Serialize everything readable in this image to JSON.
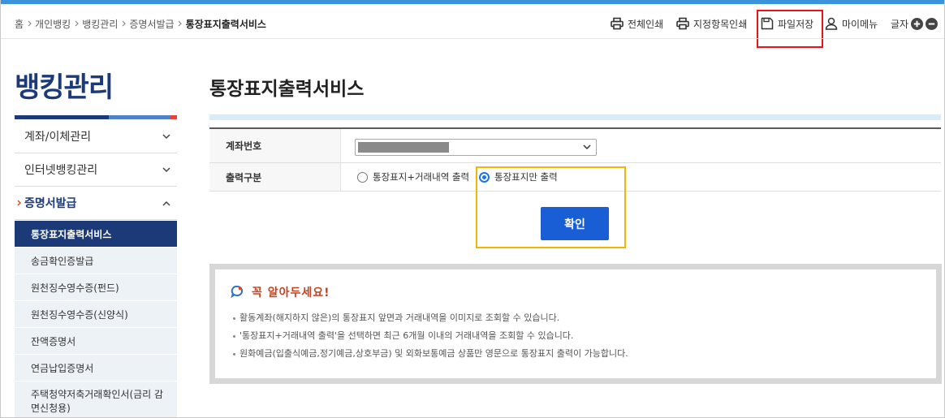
{
  "breadcrumb": {
    "home": "홈",
    "items": [
      "개인뱅킹",
      "뱅킹관리",
      "증명서발급"
    ],
    "current": "통장표지출력서비스"
  },
  "toolbar": {
    "print_all": "전체인쇄",
    "print_selected": "지정항목인쇄",
    "file_save": "파일저장",
    "my_menu": "마이메뉴",
    "font_size": "글자"
  },
  "sidebar": {
    "title": "뱅킹관리",
    "menu": [
      {
        "label": "계좌/이체관리",
        "expanded": false
      },
      {
        "label": "인터넷뱅킹관리",
        "expanded": false
      },
      {
        "label": "증명서발급",
        "expanded": true
      }
    ],
    "submenu": [
      {
        "label": "통장표지출력서비스",
        "active": true
      },
      {
        "label": "송금확인증발급",
        "active": false
      },
      {
        "label": "원천징수영수증(펀드)",
        "active": false
      },
      {
        "label": "원천징수영수증(신양식)",
        "active": false
      },
      {
        "label": "잔액증명서",
        "active": false
      },
      {
        "label": "연금납입증명서",
        "active": false
      },
      {
        "label": "주택청약저축거래확인서(금리 감면신청용)",
        "active": false
      }
    ]
  },
  "main": {
    "title": "통장표지출력서비스",
    "form": {
      "account_label": "계좌번호",
      "output_label": "출력구분",
      "output_options": [
        {
          "label": "통장표지+거래내역 출력",
          "checked": false
        },
        {
          "label": "통장표지만 출력",
          "checked": true
        }
      ]
    },
    "confirm_label": "확인"
  },
  "notice": {
    "title": "꼭 알아두세요!",
    "items": [
      "활동계좌(해지하지 않은)의 통장표지 앞면과 거래내역을 이미지로 조회할 수 있습니다.",
      "'통장표지+거래내역 출력'을 선택하면 최근 6개월 이내의 거래내역을 조회할 수 있습니다.",
      "원화예금(입출식예금,정기예금,상호부금) 및 외화보통예금 상품만 영문으로 통장표지 출력이 가능합니다."
    ]
  },
  "icons": {
    "print_all": "printer-icon",
    "print_selected": "printer-icon",
    "file_save": "save-icon",
    "my_menu": "person-icon",
    "font_increase": "plus-circle-icon",
    "font_decrease": "minus-circle-icon",
    "menu_collapsed": "chevron-down-icon",
    "menu_expanded": "chevron-up-icon",
    "notice": "notice-icon"
  },
  "colors": {
    "top_bar": "#3a93db",
    "brand_navy": "#1d3a78",
    "button_blue": "#1a5ed6",
    "highlight_red": "#e8141a",
    "highlight_yellow": "#f4b400",
    "notice_title": "#c4421f"
  }
}
